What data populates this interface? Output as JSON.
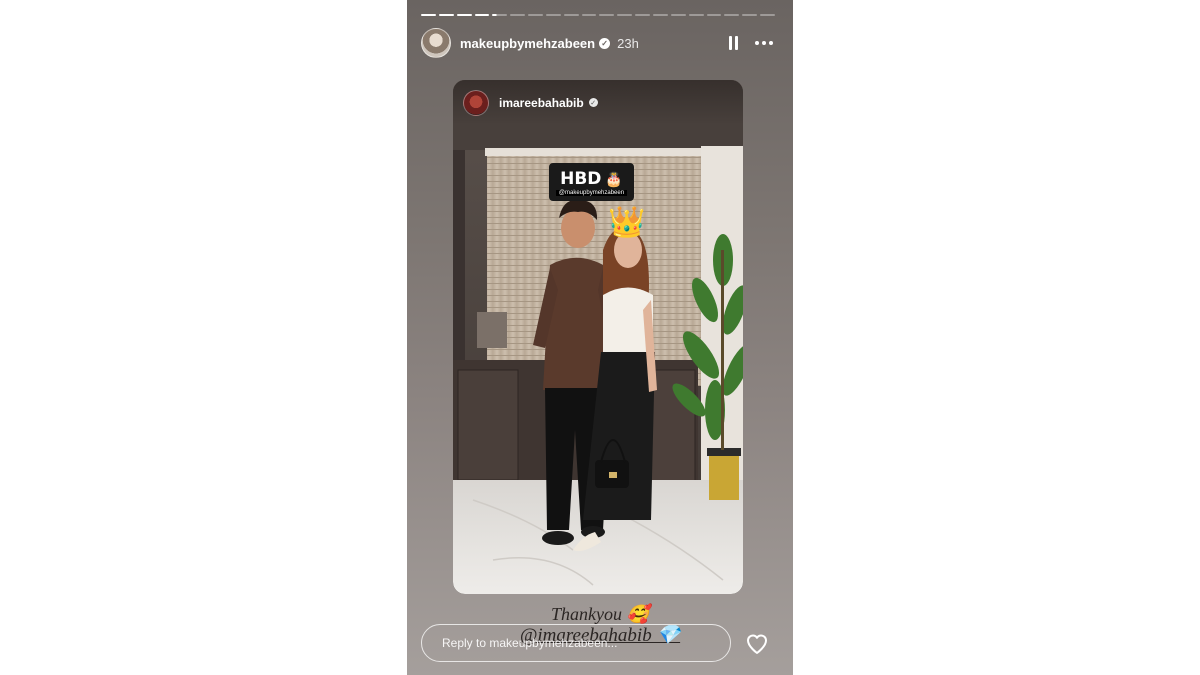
{
  "story": {
    "username": "makeupbymehzabeen",
    "time_ago": "23h",
    "progress_segments_total": 20,
    "progress_segments_completed": 4,
    "icons": {
      "avatar": "profile-avatar",
      "verified": "verified-badge-icon",
      "pause": "pause-icon",
      "more": "more-horizontal-icon",
      "heart": "heart-icon"
    }
  },
  "shared_post": {
    "username": "imareebahabib",
    "sticker_text": "HBD",
    "sticker_emoji": "🎂",
    "sticker_mention": "@makeupbymehzabeen",
    "crown_emoji": "👑"
  },
  "caption": {
    "line1": "Thankyou 🥰",
    "line2": "@imareebahabib 💎"
  },
  "reply": {
    "placeholder": "Reply to makeupbymehzabeen..."
  }
}
